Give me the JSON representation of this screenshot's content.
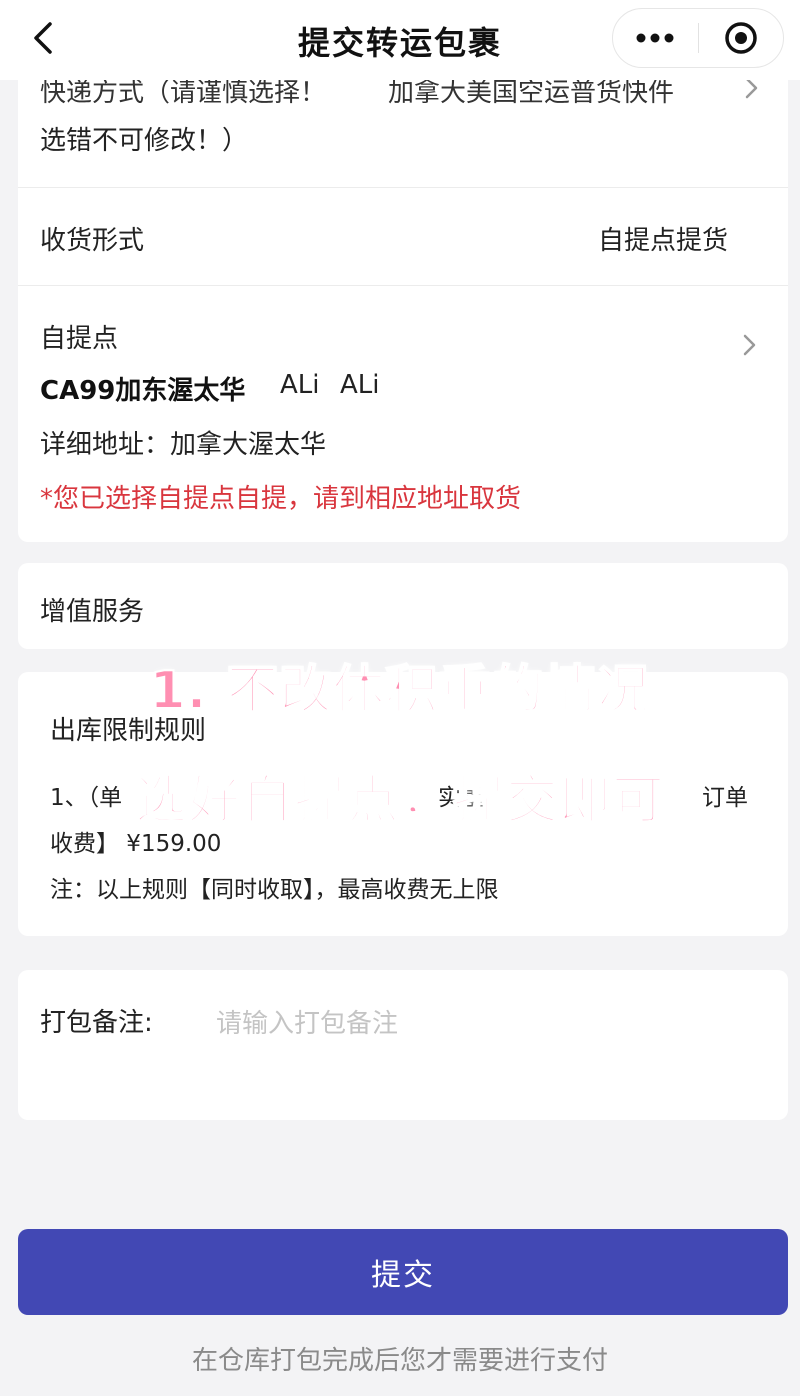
{
  "nav": {
    "title": "提交转运包裹",
    "more_icon": "more-dots-icon",
    "target_icon": "target-circle-icon"
  },
  "shipping": {
    "label_line1": "快递方式（请谨慎选择！",
    "label_line1_right": "加拿大美国空运普货快件",
    "label_line2": "选错不可修改！）"
  },
  "receive": {
    "label": "收货形式",
    "value": "自提点提货"
  },
  "pickup": {
    "label": "自提点",
    "name": "CA99加东渥太华",
    "contact1": "ALi",
    "contact2": "ALi",
    "address": "详细地址：加拿大渥太华",
    "notice": "*您已选择自提点自提，请到相应地址取货"
  },
  "value_added": {
    "label": "增值服务"
  },
  "rules": {
    "title": "出库限制规则",
    "line1_left": "1、（单",
    "line1_mid": "实重",
    "line1_right": "订单",
    "line2": "收费】 ¥159.00",
    "note": "注：以上规则【同时收取】，最高收费无上限"
  },
  "overlay": {
    "line1": "1. 不改体积重的情况",
    "line2": "选好自提点，提交即可"
  },
  "remark": {
    "label": "打包备注:",
    "placeholder": "请输入打包备注"
  },
  "actions": {
    "submit_label": "提交",
    "footer_note": "在仓库打包完成后您才需要进行支付"
  },
  "colors": {
    "primary": "#4248b4",
    "warning_text": "#d9363e",
    "overlay_pink": "#ff8fb2"
  }
}
